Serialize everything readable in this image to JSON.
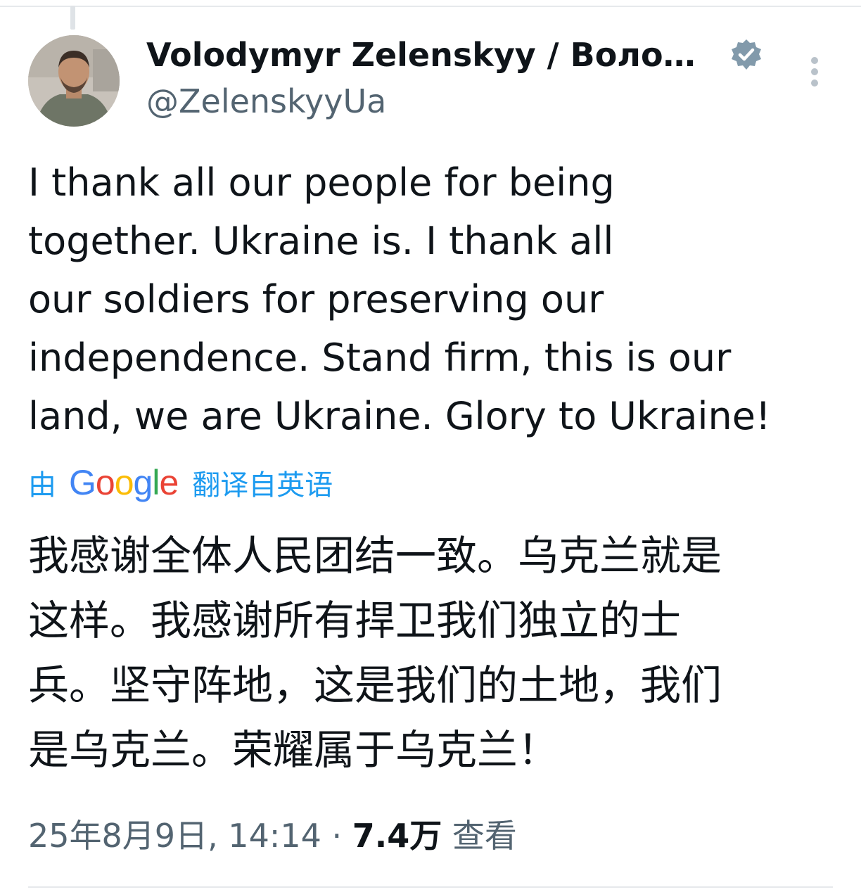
{
  "tweet": {
    "author": {
      "display_name": "Volodymyr Zelenskyy / Воло…",
      "handle": "@ZelenskyyUa",
      "verified": true
    },
    "text_lines": [
      "I thank all our people for being",
      "together. Ukraine is. I thank all",
      "our soldiers for preserving our",
      "independence. Stand firm, this is our",
      "land, we are Ukraine. Glory to Ukraine!"
    ],
    "translation": {
      "by_label": "由",
      "provider": "Google",
      "from_label": "翻译自英语"
    },
    "translated_lines": [
      "我感谢全体人民团结一致。乌克兰就是",
      "这样。我感谢所有捍卫我们独立的士",
      "兵。坚守阵地，这是我们的土地，我们",
      "是乌克兰。荣耀属于乌克兰！"
    ],
    "meta": {
      "date_time": "25年8月9日, 14:14",
      "separator": " · ",
      "views_count": "7.4万",
      "views_label": " 查看"
    }
  },
  "icons": {
    "verified": "verified-badge-icon",
    "more": "more-options-icon"
  },
  "colors": {
    "text_primary": "#0f1419",
    "text_secondary": "#536471",
    "link_blue": "#1d9bf0",
    "verified_gray": "#829aab",
    "border": "#e6e9ec"
  }
}
